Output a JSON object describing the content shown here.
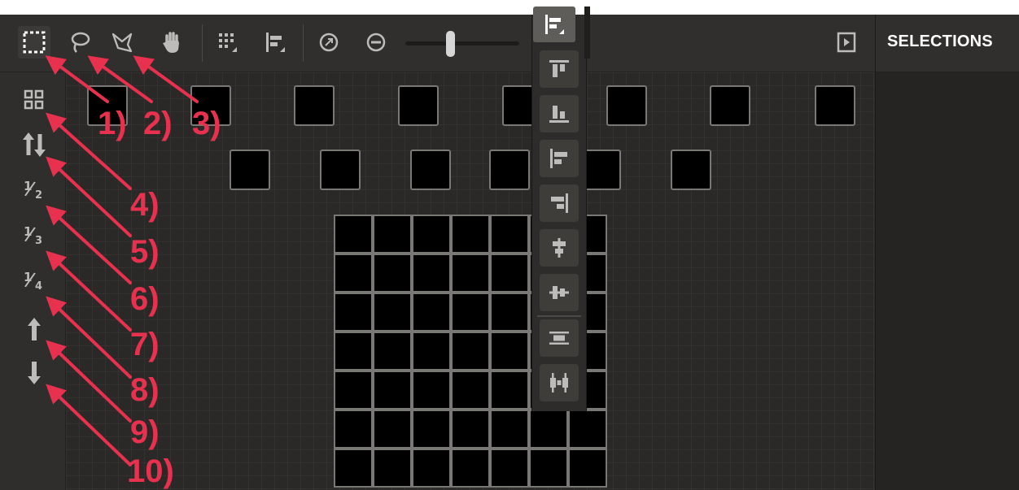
{
  "panel": {
    "title": "SELECTIONS"
  },
  "toolbar": {
    "tools": [
      "rect-select-icon",
      "lasso-select-icon",
      "magic-select-icon",
      "hand-pan-icon"
    ],
    "zoom_level": 0.45
  },
  "left_bar": {
    "buttons": [
      "grid-arrange-icon",
      "swap-order-icon",
      "one-half",
      "one-third",
      "one-quarter",
      "move-up-icon",
      "move-down-icon"
    ],
    "fractions": [
      {
        "num": "1",
        "den": "2"
      },
      {
        "num": "1",
        "den": "3"
      },
      {
        "num": "1",
        "den": "4"
      }
    ]
  },
  "align_menu": {
    "items": [
      "align-top-icon",
      "align-bottom-icon",
      "align-left-icon",
      "align-right-icon",
      "align-center-vertical-icon",
      "align-center-horizontal-icon",
      "distribute-vertical-icon",
      "distribute-horizontal-icon"
    ]
  },
  "annotations": {
    "labels": [
      "1)",
      "2)",
      "3)",
      "4)",
      "5)",
      "6)",
      "7)",
      "8)",
      "9)",
      "10)"
    ]
  },
  "colors": {
    "accent": "#e8314f",
    "background": "#2b2a28",
    "cell": "#000000",
    "cell_border": "#7a7875"
  }
}
